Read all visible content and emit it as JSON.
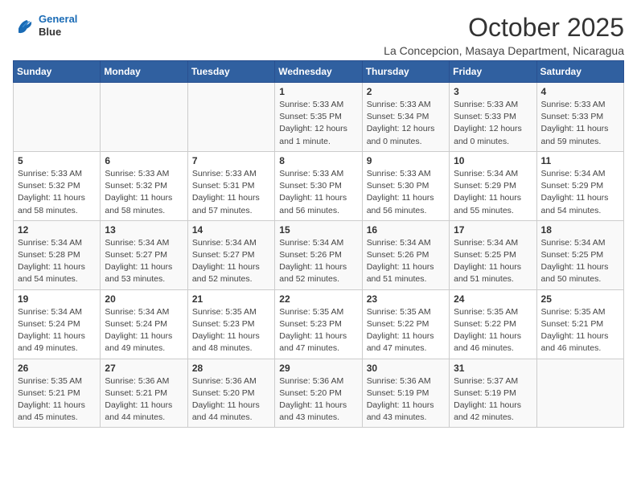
{
  "header": {
    "logo_line1": "General",
    "logo_line2": "Blue",
    "month_title": "October 2025",
    "subtitle": "La Concepcion, Masaya Department, Nicaragua"
  },
  "days_of_week": [
    "Sunday",
    "Monday",
    "Tuesday",
    "Wednesday",
    "Thursday",
    "Friday",
    "Saturday"
  ],
  "weeks": [
    [
      {
        "num": "",
        "info": ""
      },
      {
        "num": "",
        "info": ""
      },
      {
        "num": "",
        "info": ""
      },
      {
        "num": "1",
        "info": "Sunrise: 5:33 AM\nSunset: 5:35 PM\nDaylight: 12 hours\nand 1 minute."
      },
      {
        "num": "2",
        "info": "Sunrise: 5:33 AM\nSunset: 5:34 PM\nDaylight: 12 hours\nand 0 minutes."
      },
      {
        "num": "3",
        "info": "Sunrise: 5:33 AM\nSunset: 5:33 PM\nDaylight: 12 hours\nand 0 minutes."
      },
      {
        "num": "4",
        "info": "Sunrise: 5:33 AM\nSunset: 5:33 PM\nDaylight: 11 hours\nand 59 minutes."
      }
    ],
    [
      {
        "num": "5",
        "info": "Sunrise: 5:33 AM\nSunset: 5:32 PM\nDaylight: 11 hours\nand 58 minutes."
      },
      {
        "num": "6",
        "info": "Sunrise: 5:33 AM\nSunset: 5:32 PM\nDaylight: 11 hours\nand 58 minutes."
      },
      {
        "num": "7",
        "info": "Sunrise: 5:33 AM\nSunset: 5:31 PM\nDaylight: 11 hours\nand 57 minutes."
      },
      {
        "num": "8",
        "info": "Sunrise: 5:33 AM\nSunset: 5:30 PM\nDaylight: 11 hours\nand 56 minutes."
      },
      {
        "num": "9",
        "info": "Sunrise: 5:33 AM\nSunset: 5:30 PM\nDaylight: 11 hours\nand 56 minutes."
      },
      {
        "num": "10",
        "info": "Sunrise: 5:34 AM\nSunset: 5:29 PM\nDaylight: 11 hours\nand 55 minutes."
      },
      {
        "num": "11",
        "info": "Sunrise: 5:34 AM\nSunset: 5:29 PM\nDaylight: 11 hours\nand 54 minutes."
      }
    ],
    [
      {
        "num": "12",
        "info": "Sunrise: 5:34 AM\nSunset: 5:28 PM\nDaylight: 11 hours\nand 54 minutes."
      },
      {
        "num": "13",
        "info": "Sunrise: 5:34 AM\nSunset: 5:27 PM\nDaylight: 11 hours\nand 53 minutes."
      },
      {
        "num": "14",
        "info": "Sunrise: 5:34 AM\nSunset: 5:27 PM\nDaylight: 11 hours\nand 52 minutes."
      },
      {
        "num": "15",
        "info": "Sunrise: 5:34 AM\nSunset: 5:26 PM\nDaylight: 11 hours\nand 52 minutes."
      },
      {
        "num": "16",
        "info": "Sunrise: 5:34 AM\nSunset: 5:26 PM\nDaylight: 11 hours\nand 51 minutes."
      },
      {
        "num": "17",
        "info": "Sunrise: 5:34 AM\nSunset: 5:25 PM\nDaylight: 11 hours\nand 51 minutes."
      },
      {
        "num": "18",
        "info": "Sunrise: 5:34 AM\nSunset: 5:25 PM\nDaylight: 11 hours\nand 50 minutes."
      }
    ],
    [
      {
        "num": "19",
        "info": "Sunrise: 5:34 AM\nSunset: 5:24 PM\nDaylight: 11 hours\nand 49 minutes."
      },
      {
        "num": "20",
        "info": "Sunrise: 5:34 AM\nSunset: 5:24 PM\nDaylight: 11 hours\nand 49 minutes."
      },
      {
        "num": "21",
        "info": "Sunrise: 5:35 AM\nSunset: 5:23 PM\nDaylight: 11 hours\nand 48 minutes."
      },
      {
        "num": "22",
        "info": "Sunrise: 5:35 AM\nSunset: 5:23 PM\nDaylight: 11 hours\nand 47 minutes."
      },
      {
        "num": "23",
        "info": "Sunrise: 5:35 AM\nSunset: 5:22 PM\nDaylight: 11 hours\nand 47 minutes."
      },
      {
        "num": "24",
        "info": "Sunrise: 5:35 AM\nSunset: 5:22 PM\nDaylight: 11 hours\nand 46 minutes."
      },
      {
        "num": "25",
        "info": "Sunrise: 5:35 AM\nSunset: 5:21 PM\nDaylight: 11 hours\nand 46 minutes."
      }
    ],
    [
      {
        "num": "26",
        "info": "Sunrise: 5:35 AM\nSunset: 5:21 PM\nDaylight: 11 hours\nand 45 minutes."
      },
      {
        "num": "27",
        "info": "Sunrise: 5:36 AM\nSunset: 5:21 PM\nDaylight: 11 hours\nand 44 minutes."
      },
      {
        "num": "28",
        "info": "Sunrise: 5:36 AM\nSunset: 5:20 PM\nDaylight: 11 hours\nand 44 minutes."
      },
      {
        "num": "29",
        "info": "Sunrise: 5:36 AM\nSunset: 5:20 PM\nDaylight: 11 hours\nand 43 minutes."
      },
      {
        "num": "30",
        "info": "Sunrise: 5:36 AM\nSunset: 5:19 PM\nDaylight: 11 hours\nand 43 minutes."
      },
      {
        "num": "31",
        "info": "Sunrise: 5:37 AM\nSunset: 5:19 PM\nDaylight: 11 hours\nand 42 minutes."
      },
      {
        "num": "",
        "info": ""
      }
    ]
  ]
}
